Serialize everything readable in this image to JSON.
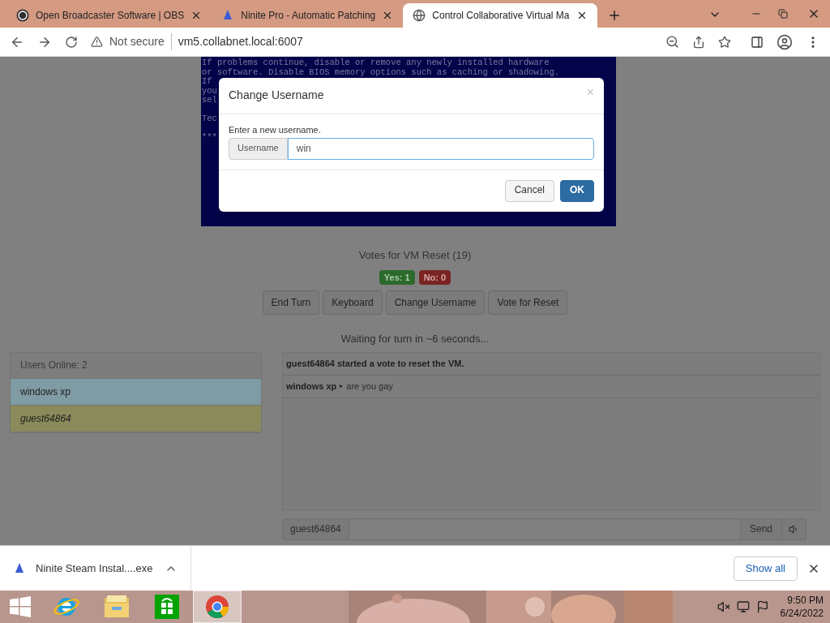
{
  "browser": {
    "tabs": [
      {
        "title": "Open Broadcaster Software | OBS",
        "kind": "obs",
        "selected": false
      },
      {
        "title": "Ninite Pro - Automatic Patching",
        "kind": "ninite",
        "selected": false
      },
      {
        "title": "Control Collaborative Virtual Ma",
        "kind": "globe",
        "selected": true
      }
    ],
    "security": "Not secure",
    "url": "vm5.collabnet.local:6007"
  },
  "vm_screen": {
    "paragraphs": [
      [
        "If problems continue, disable or remove any newly installed hardware",
        "or software. Disable BIOS memory options such as caching or shadowing.",
        "If",
        "you",
        "sel"
      ],
      [
        "Tec"
      ],
      [
        "***"
      ]
    ]
  },
  "votes": {
    "title": "Votes for VM Reset (19)",
    "yes": "Yes: 1",
    "no": "No: 0"
  },
  "buttons": [
    "End Turn",
    "Keyboard",
    "Change Username",
    "Vote for Reset"
  ],
  "turn_status": "Waiting for turn in ~6 seconds...",
  "users": {
    "header": "Users Online: 2",
    "items": [
      {
        "name": "windows xp",
        "color": "#7f9ba4",
        "italic": false
      },
      {
        "name": "guest64864",
        "color": "#8a8a5a",
        "italic": true
      }
    ]
  },
  "chat": {
    "messages": [
      {
        "kind": "system",
        "text": "guest64864 started a vote to reset the VM."
      },
      {
        "kind": "user",
        "user": "windows xp",
        "separator": "▸",
        "text": "are you gay"
      }
    ],
    "username": "guest64864",
    "send": "Send"
  },
  "modal": {
    "title": "Change Username",
    "close": "×",
    "prompt": "Enter a new username.",
    "addon": "Username",
    "value": "win",
    "cancel": "Cancel",
    "ok": "OK"
  },
  "downloads": {
    "file": "Ninite Steam Instal....exe",
    "show_all": "Show all"
  },
  "taskbar": {
    "apps": [
      {
        "kind": "ie",
        "selected": false
      },
      {
        "kind": "explorer",
        "selected": false
      },
      {
        "kind": "store",
        "selected": false
      },
      {
        "kind": "chrome",
        "selected": true
      }
    ],
    "time": "9:50 PM",
    "date": "6/24/2022"
  }
}
